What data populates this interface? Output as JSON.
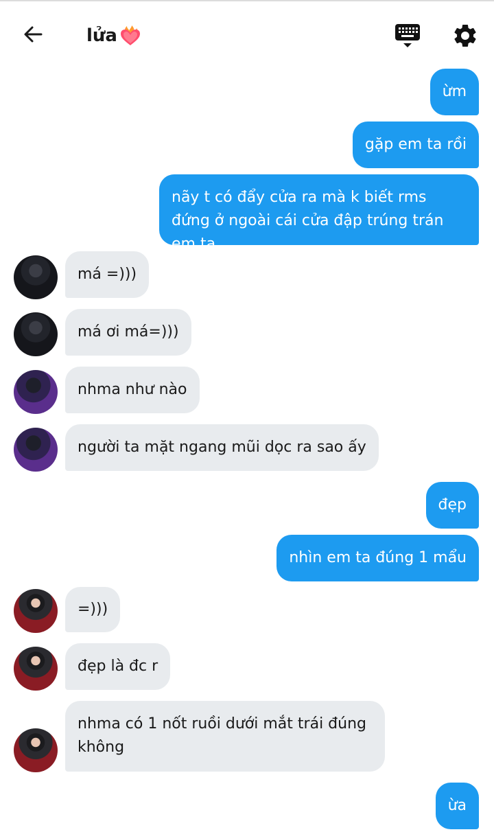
{
  "header": {
    "title": "lửa",
    "colors": {
      "accent": "#1d9bf0",
      "incoming_bubble": "#e8ebee",
      "title": "#1a1a1a"
    },
    "icons": {
      "back": "arrow-left-icon",
      "emoji": "burning-heart-icon",
      "keyboard": "keyboard-icon",
      "settings": "gear-icon"
    }
  },
  "messages": [
    {
      "dir": "out",
      "text": "ừm"
    },
    {
      "dir": "out",
      "text": "gặp em ta rồi"
    },
    {
      "dir": "out",
      "text": "nãy t có đẩy cửa ra mà k biết rms đứng ở ngoài cái cửa đập trúng trán em ta"
    },
    {
      "dir": "in",
      "text": "má =)))"
    },
    {
      "dir": "in",
      "text": "má ơi má=)))"
    },
    {
      "dir": "in",
      "text": "nhma như nào"
    },
    {
      "dir": "in",
      "text": "người ta mặt ngang mũi dọc ra sao ấy"
    },
    {
      "dir": "out",
      "text": "đẹp"
    },
    {
      "dir": "out",
      "text": "nhìn em ta đúng 1 mẩu"
    },
    {
      "dir": "in",
      "text": "=)))"
    },
    {
      "dir": "in",
      "text": "đẹp là đc r"
    },
    {
      "dir": "in",
      "text": "nhma có 1 nốt ruồi dưới mắt trái đúng không"
    },
    {
      "dir": "out",
      "text": "ừa"
    }
  ]
}
